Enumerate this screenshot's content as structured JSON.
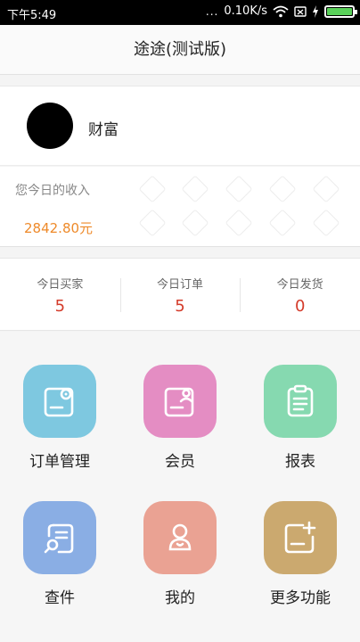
{
  "status_bar": {
    "time": "下午5:49",
    "signal_dots": "...",
    "speed": "0.10K/s",
    "battery_color": "#5ad15a"
  },
  "header": {
    "title": "途途(测试版)"
  },
  "user": {
    "name": "财富"
  },
  "income": {
    "label": "您今日的收入",
    "amount": "2842.80元",
    "amount_color": "#ee8a2a"
  },
  "stats": [
    {
      "label": "今日买家",
      "value": "5"
    },
    {
      "label": "今日订单",
      "value": "5"
    },
    {
      "label": "今日发货",
      "value": "0"
    }
  ],
  "menu": [
    {
      "label": "订单管理",
      "icon": "order-settings-icon",
      "color": "#7ec8e0"
    },
    {
      "label": "会员",
      "icon": "member-icon",
      "color": "#e48dc3"
    },
    {
      "label": "报表",
      "icon": "clipboard-icon",
      "color": "#86d9b0"
    },
    {
      "label": "查件",
      "icon": "document-search-icon",
      "color": "#8aaee4"
    },
    {
      "label": "我的",
      "icon": "profile-icon",
      "color": "#eaa293"
    },
    {
      "label": "更多功能",
      "icon": "add-document-icon",
      "color": "#cba96f"
    }
  ]
}
